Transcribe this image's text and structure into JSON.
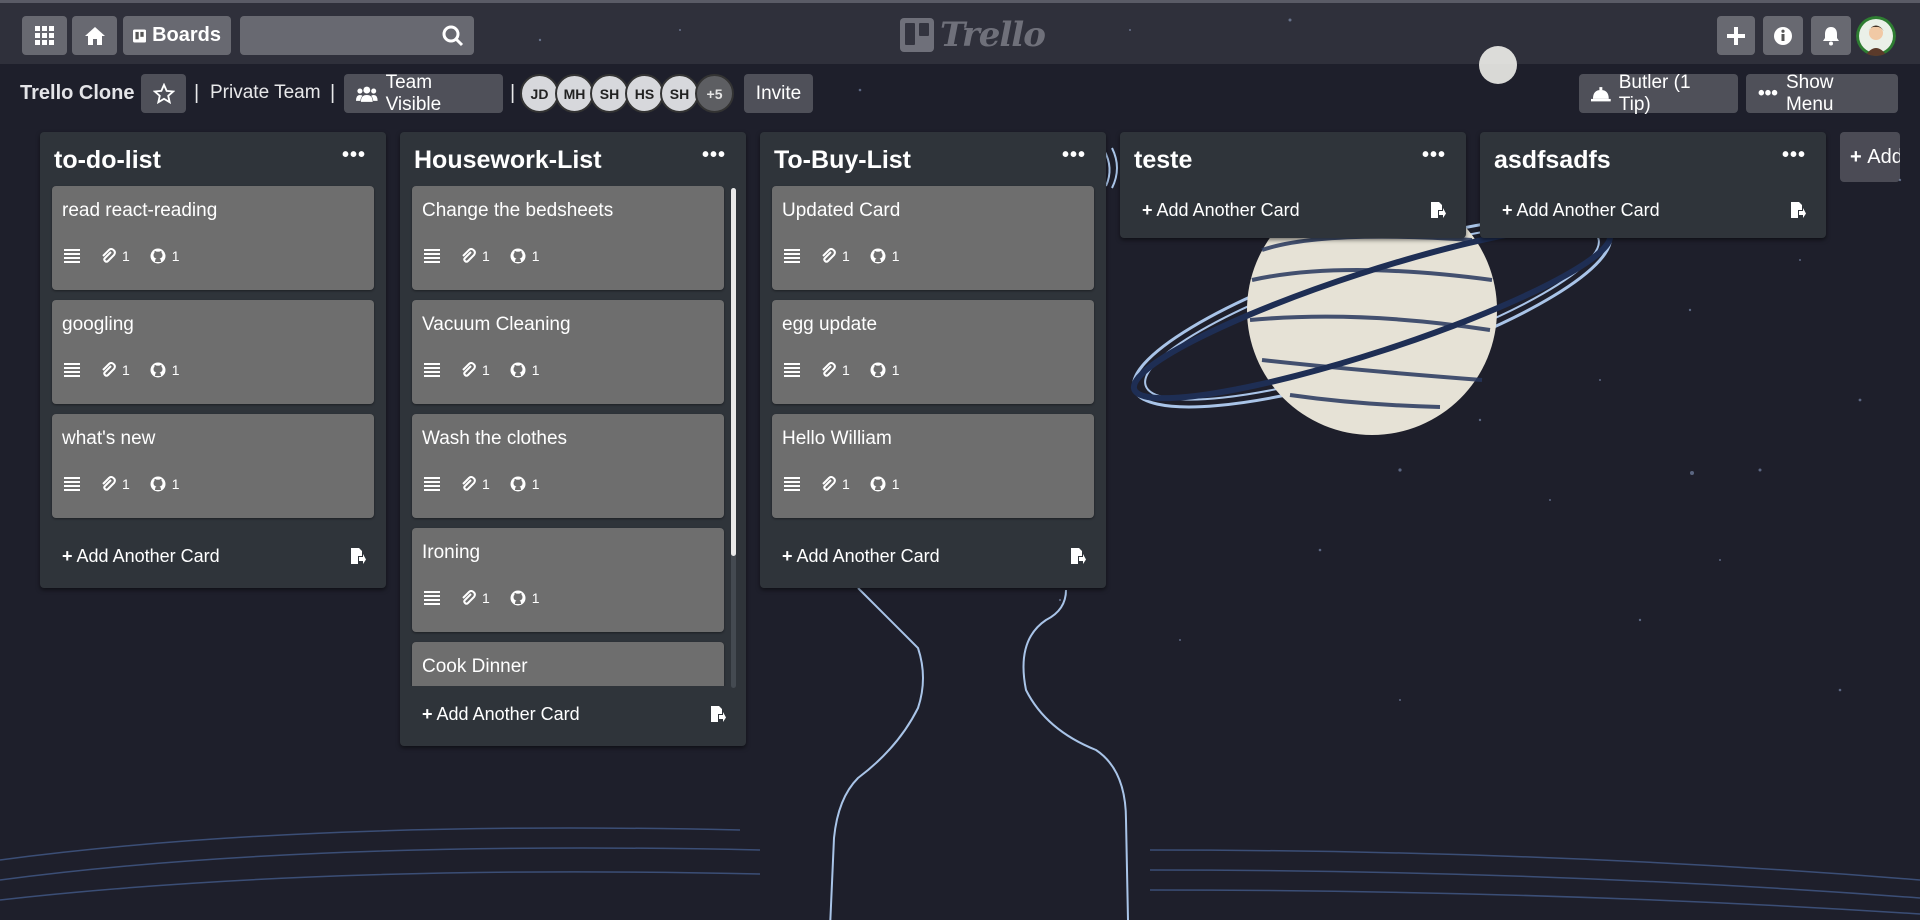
{
  "nav": {
    "boards_label": "Boards",
    "search_value": "",
    "logo_text": "Trello"
  },
  "board": {
    "title": "Trello Clone",
    "team": "Private Team",
    "visibility": "Team Visible",
    "members": [
      "JD",
      "MH",
      "SH",
      "HS",
      "SH"
    ],
    "more_members": "+5",
    "invite_label": "Invite",
    "butler_label": "Butler (1 Tip)",
    "menu_label": "Show Menu"
  },
  "lists": [
    {
      "title": "to-do-list",
      "cards": [
        {
          "title": "read react-reading",
          "attachments": "1",
          "github": "1"
        },
        {
          "title": "googling",
          "attachments": "1",
          "github": "1"
        },
        {
          "title": "what's new",
          "attachments": "1",
          "github": "1"
        }
      ],
      "add_label": "Add Another Card"
    },
    {
      "title": "Housework-List",
      "cards": [
        {
          "title": "Change the bedsheets",
          "attachments": "1",
          "github": "1"
        },
        {
          "title": "Vacuum Cleaning",
          "attachments": "1",
          "github": "1"
        },
        {
          "title": "Wash the clothes",
          "attachments": "1",
          "github": "1"
        },
        {
          "title": "Ironing",
          "attachments": "1",
          "github": "1"
        },
        {
          "title": "Cook Dinner",
          "attachments": "",
          "github": ""
        }
      ],
      "add_label": "Add Another Card"
    },
    {
      "title": "To-Buy-List",
      "cards": [
        {
          "title": "Updated Card",
          "attachments": "1",
          "github": "1"
        },
        {
          "title": "egg update",
          "attachments": "1",
          "github": "1"
        },
        {
          "title": "Hello William",
          "attachments": "1",
          "github": "1"
        }
      ],
      "add_label": "Add Another Card"
    },
    {
      "title": "teste",
      "cards": [],
      "add_label": "Add Another Card"
    },
    {
      "title": "asdfsadfs",
      "cards": [],
      "add_label": "Add Another Card"
    }
  ],
  "add_list_label": "Add",
  "colors": {
    "background": "#1e1f2b",
    "list": "#2f343a",
    "card": "#6e6e6e",
    "planet": "#e6e2d6",
    "outline": "#a9c4e8"
  }
}
